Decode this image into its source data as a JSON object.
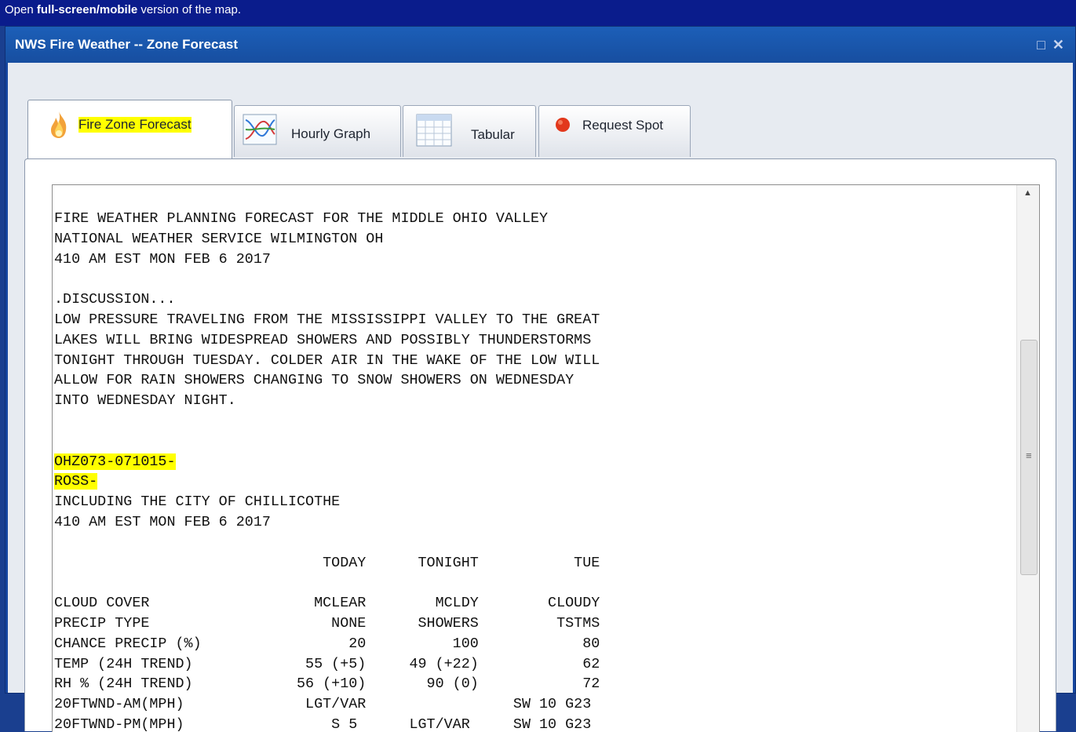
{
  "topbar": {
    "pre": "Open ",
    "bold": "full-screen/mobile",
    "post": " version of the map."
  },
  "window": {
    "title": "NWS Fire Weather -- Zone Forecast",
    "maximize_glyph": "□",
    "close_glyph": "✕"
  },
  "tabs": [
    {
      "label": "Fire Zone Forecast",
      "icon": "fire-icon",
      "active": true
    },
    {
      "label": "Hourly Graph",
      "icon": "graph-icon"
    },
    {
      "label": "Tabular",
      "icon": "table-icon"
    },
    {
      "label": "Request Spot",
      "icon": "red-dot-icon"
    }
  ],
  "scrollbar": {
    "up": "▲",
    "grip": "≡"
  },
  "forecast": {
    "header1": "FIRE WEATHER PLANNING FORECAST FOR THE MIDDLE OHIO VALLEY",
    "header2": "NATIONAL WEATHER SERVICE WILMINGTON OH",
    "header3": "410 AM EST MON FEB 6 2017",
    "disc_title": ".DISCUSSION...",
    "disc1": "LOW PRESSURE TRAVELING FROM THE MISSISSIPPI VALLEY TO THE GREAT",
    "disc2": "LAKES WILL BRING WIDESPREAD SHOWERS AND POSSIBLY THUNDERSTORMS",
    "disc3": "TONIGHT THROUGH TUESDAY. COLDER AIR IN THE WAKE OF THE LOW WILL",
    "disc4": "ALLOW FOR RAIN SHOWERS CHANGING TO SNOW SHOWERS ON WEDNESDAY",
    "disc5": "INTO WEDNESDAY NIGHT.",
    "zone": "OHZ073-071015-",
    "county": "ROSS-",
    "city": "INCLUDING THE CITY OF CHILLICOTHE",
    "time": "410 AM EST MON FEB 6 2017",
    "table_header": "                               TODAY      TONIGHT           TUE",
    "rows": [
      "CLOUD COVER                   MCLEAR        MCLDY        CLOUDY",
      "PRECIP TYPE                     NONE      SHOWERS         TSTMS",
      "CHANCE PRECIP (%)                 20          100            80",
      "TEMP (24H TREND)             55 (+5)     49 (+22)            62",
      "RH % (24H TREND)            56 (+10)       90 (0)            72",
      "20FTWND-AM(MPH)              LGT/VAR                 SW 10 G23",
      "20FTWND-PM(MPH)                 S 5      LGT/VAR     SW 10 G23"
    ]
  }
}
